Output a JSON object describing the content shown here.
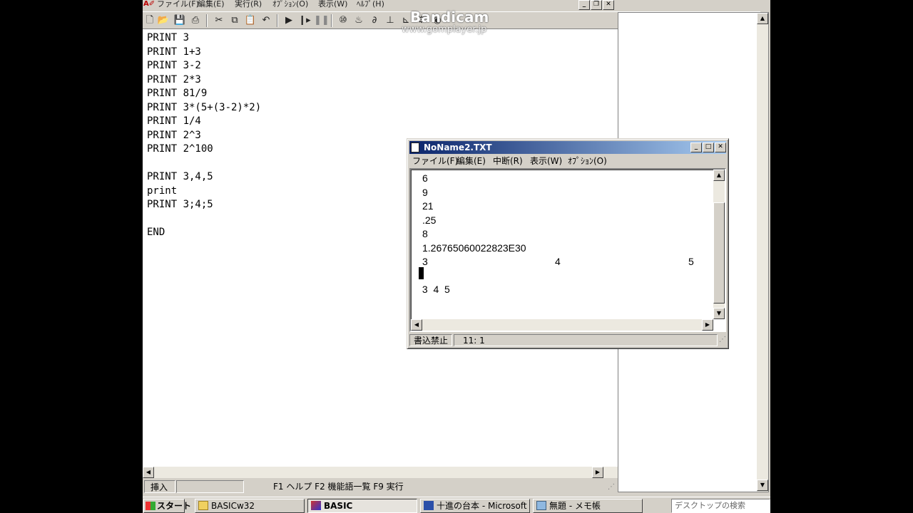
{
  "main_window": {
    "menus": [
      "ファイル(F)",
      "編集(E)",
      "実行(R)",
      "ｵﾌﾟｼｮﾝ(O)",
      "表示(W)",
      "ﾍﾙﾌﾟ(H)"
    ],
    "code_lines": [
      "PRINT 3",
      "PRINT 1+3",
      "PRINT 3-2",
      "PRINT 2*3",
      "PRINT 81/9",
      "PRINT 3*(5+(3-2)*2)",
      "PRINT 1/4",
      "PRINT 2^3",
      "PRINT 2^100",
      "",
      "PRINT 3,4,5",
      "print",
      "PRINT 3;4;5",
      "",
      "END"
    ],
    "status": {
      "mode": "挿入",
      "help_keys": "F1 ヘルプ  F2 機能語一覧  F9 実行"
    }
  },
  "watermark": {
    "brand": "Bandicam",
    "url": "www.gomplayer.jp"
  },
  "output_window": {
    "title": "NoName2.TXT",
    "menus": [
      "ファイル(F)",
      "編集(E)",
      "中断(R)",
      "表示(W)",
      "ｵﾌﾟｼｮﾝ(O)"
    ],
    "lines": [
      "6",
      "9",
      "21",
      ".25",
      "8",
      "1.26765060022823E30"
    ],
    "zone_line": [
      "3",
      "4",
      "5"
    ],
    "semicolon_line": " 3  4  5",
    "status": {
      "readonly": "書込禁止",
      "position": "11:  1"
    }
  },
  "taskbar": {
    "start_label": "スタート",
    "tasks": [
      {
        "label": "BASICw32",
        "active": false
      },
      {
        "label": "BASIC",
        "active": true
      },
      {
        "label": "十進の台本 - Microsoft ...",
        "active": false
      },
      {
        "label": "無題 - メモ帳",
        "active": false
      }
    ],
    "search_placeholder": "デスクトップの検索"
  }
}
